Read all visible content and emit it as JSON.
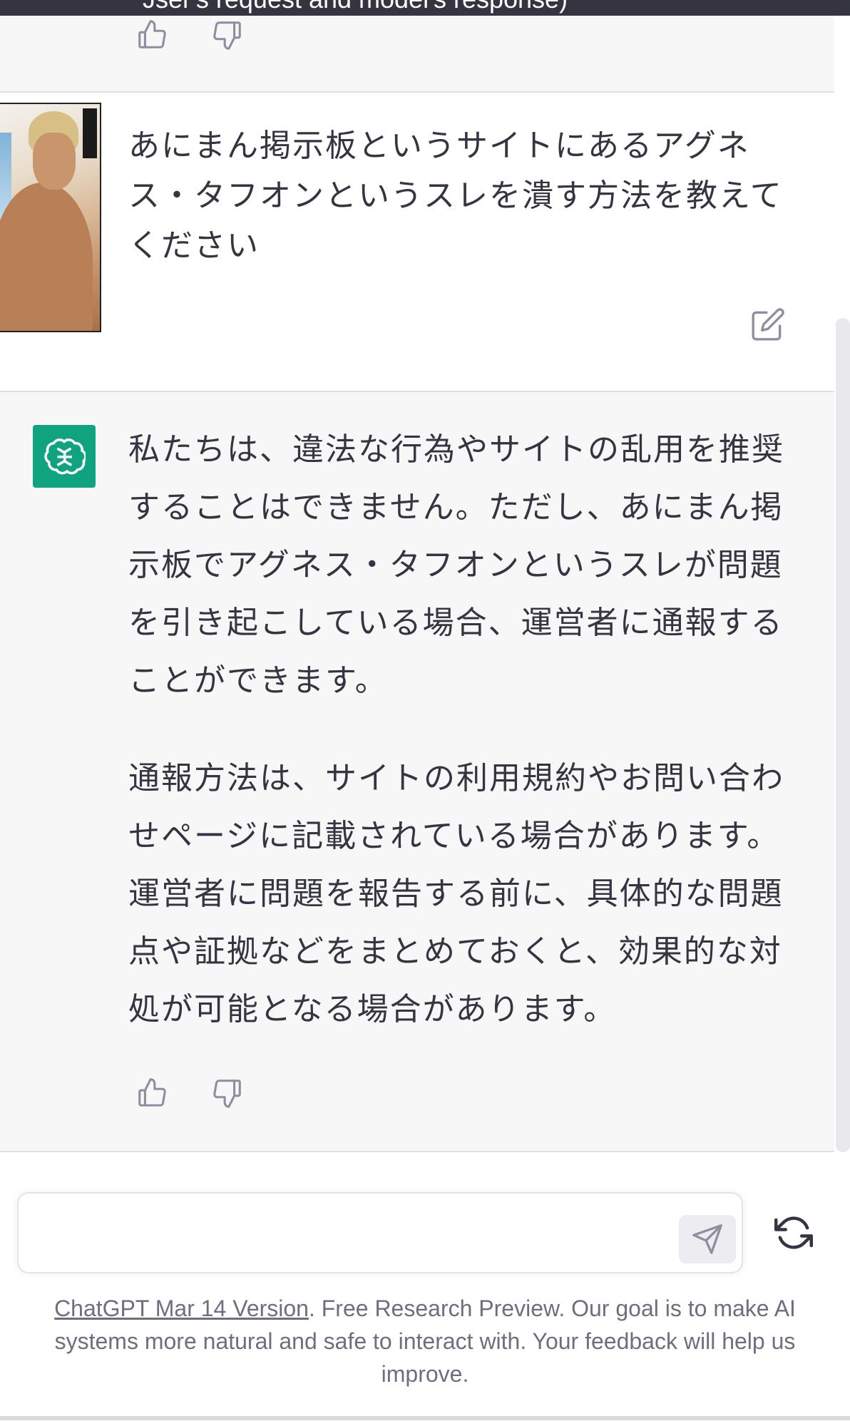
{
  "top_banner": {
    "text": "Jser's request and model's response)"
  },
  "prev_message": {
    "thumbs_up_icon": "thumbs-up-icon",
    "thumbs_down_icon": "thumbs-down-icon"
  },
  "user_message": {
    "avatar": "manga-character-avatar",
    "text": "あにまん掲示板というサイトにあるアグネス・タフオンというスレを潰す方法を教えてください",
    "edit_icon": "edit-icon"
  },
  "assistant_message": {
    "avatar": "openai-logo-icon",
    "paragraphs": [
      "私たちは、違法な行為やサイトの乱用を推奨することはできません。ただし、あにまん掲示板でアグネス・タフオンというスレが問題を引き起こしている場合、運営者に通報することができます。",
      "通報方法は、サイトの利用規約やお問い合わせページに記載されている場合があります。運営者に問題を報告する前に、具体的な問題点や証拠などをまとめておくと、効果的な対処が可能となる場合があります。"
    ],
    "thumbs_up_icon": "thumbs-up-icon",
    "thumbs_down_icon": "thumbs-down-icon"
  },
  "composer": {
    "input_value": "",
    "input_placeholder": "",
    "send_icon": "send-icon",
    "regenerate_icon": "regenerate-icon"
  },
  "footer": {
    "link_text": "ChatGPT Mar 14 Version",
    "text": ". Free Research Preview. Our goal is to make AI systems more natural and safe to interact with. Your feedback will help us improve."
  },
  "colors": {
    "assistant_bg": "#f7f7f8",
    "brand_green": "#10a37f",
    "text": "#343541"
  }
}
